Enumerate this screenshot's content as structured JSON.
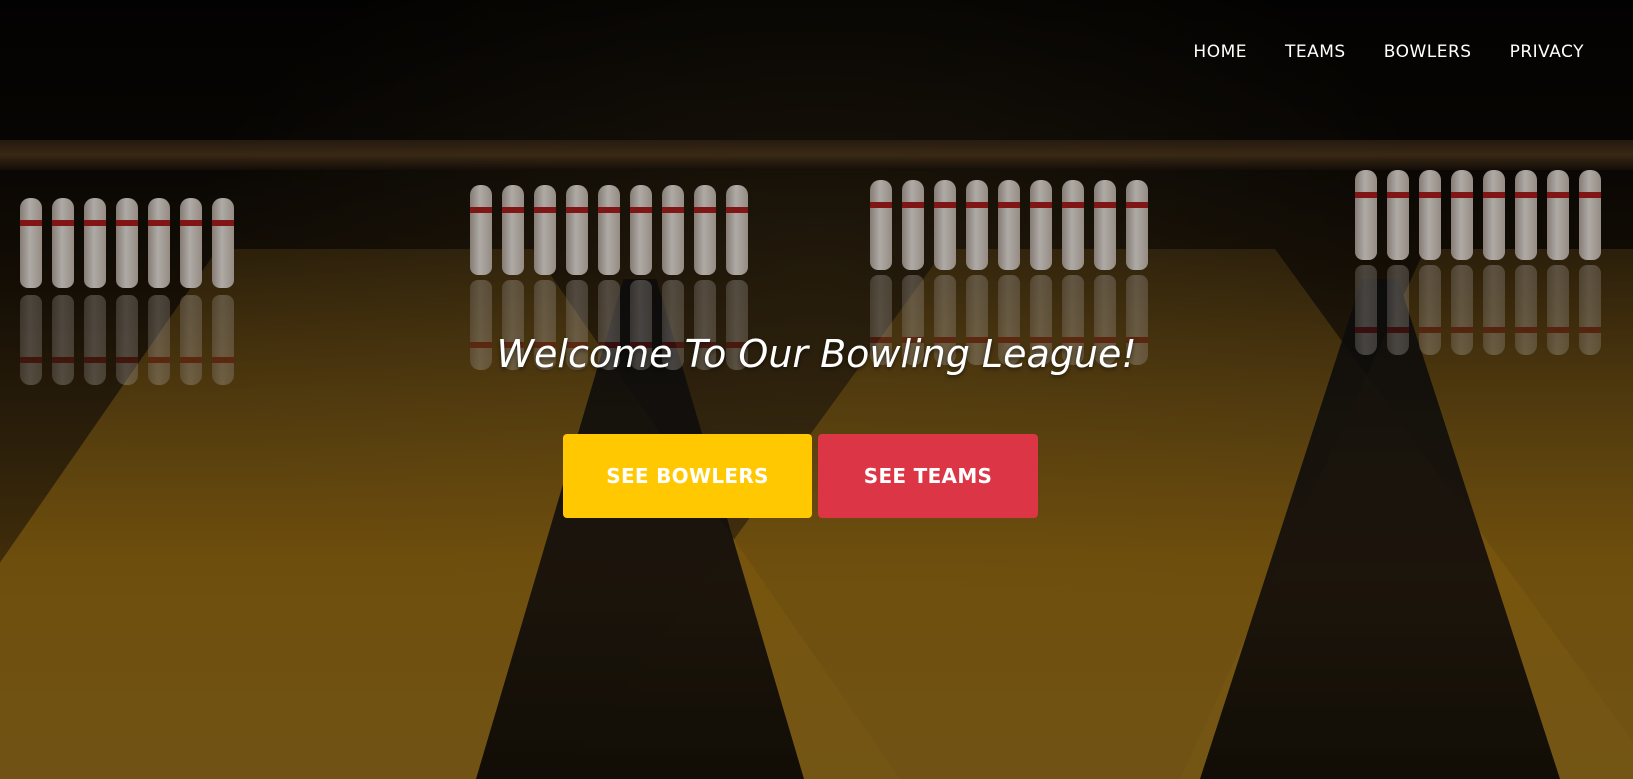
{
  "nav": {
    "items": [
      {
        "label": "HOME"
      },
      {
        "label": "TEAMS"
      },
      {
        "label": "BOWLERS"
      },
      {
        "label": "PRIVACY"
      }
    ]
  },
  "hero": {
    "title": "Welcome To Our Bowling League!",
    "background_image": "bowling-alley-lanes",
    "buttons": [
      {
        "label": "SEE BOWLERS",
        "color": "#ffc800"
      },
      {
        "label": "SEE TEAMS",
        "color": "#dc3545"
      }
    ]
  }
}
